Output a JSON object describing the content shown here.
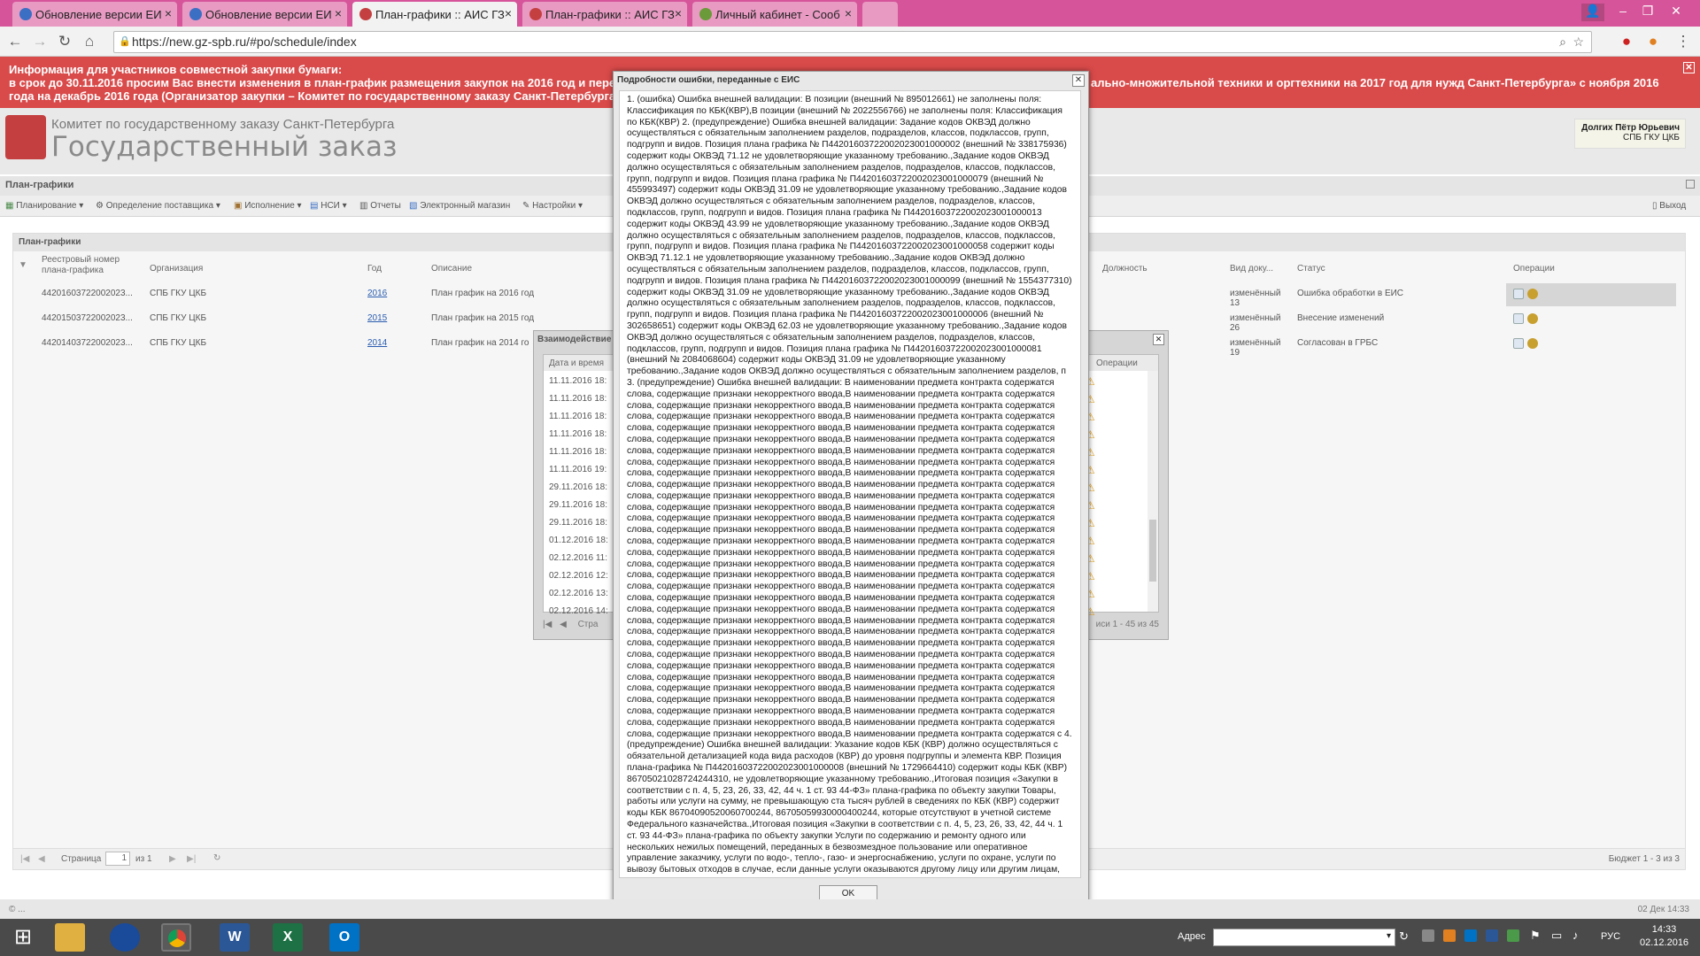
{
  "browser": {
    "tabs": [
      {
        "label": "Обновление версии ЕИ",
        "active": false
      },
      {
        "label": "Обновление версии ЕИ",
        "active": false
      },
      {
        "label": "План-графики :: АИС ГЗ",
        "active": true
      },
      {
        "label": "План-графики :: АИС ГЗ",
        "active": false
      },
      {
        "label": "Личный кабинет - Сооб",
        "active": false
      }
    ],
    "url": "https://new.gz-spb.ru/#po/schedule/index"
  },
  "notice": {
    "title": "Информация для участников совместной закупки бумаги:",
    "line2": "в срок до 30.11.2016 просим Вас внести изменения в план-график размещения закупок на 2016 год и пере",
    "line2_right": "ально-множительной техники и оргтехники на 2017 год для нужд Санкт-Петербурга» с ноября 2016",
    "line3": "года на декабрь 2016 года (Организатор закупки – Комитет по государственному заказу Санкт-Петербурга"
  },
  "header": {
    "org": "Комитет по государственному заказу Санкт-Петербурга",
    "system": "Государственный заказ",
    "user_name": "Долгих Пётр Юрьевич",
    "user_org": "СПБ ГКУ ЦКБ"
  },
  "section_title": "План-графики",
  "menu": {
    "items": [
      "Планирование ▾",
      "Определение поставщика ▾",
      "Исполнение ▾",
      "НСИ ▾",
      "Отчеты",
      "Электронный магазин",
      "Настройки ▾"
    ],
    "logout": "Выход"
  },
  "grid": {
    "title": "План-графики",
    "columns": [
      "Реестровый номер плана-графика",
      "Организация",
      "Год",
      "Описание",
      "Должность",
      "Вид доку...",
      "Статус",
      "Операции"
    ],
    "rows": [
      {
        "reg": "44201603722002023...",
        "org": "СПБ ГКУ ЦКБ",
        "year": "2016",
        "desc": "План график на 2016 год",
        "doc": "изменённый 13",
        "status": "Ошибка обработки в ЕИС"
      },
      {
        "reg": "44201503722002023...",
        "org": "СПБ ГКУ ЦКБ",
        "year": "2015",
        "desc": "План график на 2015 год",
        "doc": "изменённый 26",
        "status": "Внесение изменений"
      },
      {
        "reg": "44201403722002023...",
        "org": "СПБ ГКУ ЦКБ",
        "year": "2014",
        "desc": "План график на 2014 го",
        "doc": "изменённый 19",
        "status": "Согласован в ГРБС"
      }
    ],
    "pager": {
      "page_label": "Страница",
      "page": "1",
      "of": "из 1",
      "summary": "Бюджет 1 - 3 из 3"
    }
  },
  "subwindow": {
    "title": "Взаимодействие",
    "col_date": "Дата и время",
    "col_ops": "Операции",
    "dates": [
      "11.11.2016 18:",
      "11.11.2016 18:",
      "11.11.2016 18:",
      "11.11.2016 18:",
      "11.11.2016 18:",
      "11.11.2016 19:",
      "29.11.2016 18:",
      "29.11.2016 18:",
      "29.11.2016 18:",
      "01.12.2016 18:",
      "02.12.2016 11:",
      "02.12.2016 12:",
      "02.12.2016 13:",
      "02.12.2016 14:"
    ],
    "pager_label": "Стра",
    "summary": "иси 1 - 45 из 45"
  },
  "modal": {
    "title": "Подробности ошибки, переданные с ЕИС",
    "body": "1. (ошибка) Ошибка внешней валидации: В позиции (внешний № 895012661) не заполнены поля: Классификация по КБК(КВР),В позиции (внешний № 2022556766) не заполнены поля: Классификация по КБК(КВР) 2. (предупреждение) Ошибка внешней валидации: Задание кодов ОКВЭД должно осуществляться с обязательным заполнением разделов, подразделов, классов, подклассов, групп, подгрупп и видов. Позиция плана графика № П44201603722002023001000002 (внешний № 338175936) содержит коды ОКВЭД 71.12 не удовлетворяющие указанному требованию.,Задание кодов ОКВЭД должно осуществляться с обязательным заполнением разделов, подразделов, классов, подклассов, групп, подгрупп и видов. Позиция плана графика № П44201603722002023001000079 (внешний № 455993497) содержит коды ОКВЭД 31.09 не удовлетворяющие указанному требованию.,Задание кодов ОКВЭД должно осуществляться с обязательным заполнением разделов, подразделов, классов, подклассов, групп, подгрупп и видов. Позиция плана графика № П44201603722002023001000013 содержит коды ОКВЭД 43.99 не удовлетворяющие указанному требованию.,Задание кодов ОКВЭД должно осуществляться с обязательным заполнением разделов, подразделов, классов, подклассов, групп, подгрупп и видов. Позиция плана графика № П44201603722002023001000058 содержит коды ОКВЭД 71.12.1 не удовлетворяющие указанному требованию.,Задание кодов ОКВЭД должно осуществляться с обязательным заполнением разделов, подразделов, классов, подклассов, групп, подгрупп и видов. Позиция плана графика № П44201603722002023001000099 (внешний № 1554377310) содержит коды ОКВЭД 31.09 не удовлетворяющие указанному требованию.,Задание кодов ОКВЭД должно осуществляться с обязательным заполнением разделов, подразделов, классов, подклассов, групп, подгрупп и видов. Позиция плана графика № П44201603722002023001000006 (внешний № 302658651) содержит коды ОКВЭД 62.03 не удовлетворяющие указанному требованию.,Задание кодов ОКВЭД должно осуществляться с обязательным заполнением разделов, подразделов, классов, подклассов, групп, подгрупп и видов. Позиция плана графика № П44201603722002023001000081 (внешний № 2084068604) содержит коды ОКВЭД 31.09 не удовлетворяющие указанному требованию.,Задание кодов ОКВЭД должно осуществляться с обязательным заполнением разделов, п 3. (предупреждение) Ошибка внешней валидации: В наименовании предмета контракта содержатся слова, содержащие признаки некорректного ввода,В наименовании предмета контракта содержатся слова, содержащие признаки некорректного ввода,В наименовании предмета контракта содержатся слова, содержащие признаки некорректного ввода,В наименовании предмета контракта содержатся слова, содержащие признаки некорректного ввода,В наименовании предмета контракта содержатся слова, содержащие признаки некорректного ввода,В наименовании предмета контракта содержатся слова, содержащие признаки некорректного ввода,В наименовании предмета контракта содержатся слова, содержащие признаки некорректного ввода,В наименовании предмета контракта содержатся слова, содержащие признаки некорректного ввода,В наименовании предмета контракта содержатся слова, содержащие признаки некорректного ввода,В наименовании предмета контракта содержатся слова, содержащие признаки некорректного ввода,В наименовании предмета контракта содержатся слова, содержащие признаки некорректного ввода,В наименовании предмета контракта содержатся слова, содержащие признаки некорректного ввода,В наименовании предмета контракта содержатся слова, содержащие признаки некорректного ввода,В наименовании предмета контракта содержатся слова, содержащие признаки некорректного ввода,В наименовании предмета контракта содержатся слова, содержащие признаки некорректного ввода,В наименовании предмета контракта содержатся слова, содержащие признаки некорректного ввода,В наименовании предмета контракта содержатся слова, содержащие признаки некорректного ввода,В наименовании предмета контракта содержатся слова, содержащие признаки некорректного ввода,В наименовании предмета контракта содержатся слова, содержащие признаки некорректного ввода,В наименовании предмета контракта содержатся слова, содержащие признаки некорректного ввода,В наименовании предмета контракта содержатся слова, содержащие признаки некорректного ввода,В наименовании предмета контракта содержатся слова, содержащие признаки некорректного ввода,В наименовании предмета контракта содержатся слова, содержащие признаки некорректного ввода,В наименовании предмета контракта содержатся слова, содержащие признаки некорректного ввода,В наименовании предмета контракта содержатся слова, содержащие признаки некорректного ввода,В наименовании предмета контракта содержатся слова, содержащие признаки некорректного ввода,В наименовании предмета контракта содержатся слова, содержащие признаки некорректного ввода,В наименовании предмета контракта содержатся слова, содержащие признаки некорректного ввода,В наименовании предмета контракта содержатся слова, содержащие признаки некорректного ввода,В наименовании предмета контракта содержатся слова, содержащие признаки некорректного ввода,В наименовании предмета контракта содержатся слова, содержащие признаки некорректного ввода,В наименовании предмета контракта содержатся с 4. (предупреждение) Ошибка внешней валидации: Указание кодов КБК (КВР) должно осуществляться с обязательной детализацией кода вида расходов (КВР) до уровня подгруппы и элемента КВР. Позиция плана-графика № П44201603722002023001000008 (внешний № 1729664410) содержит коды КБК (КВР) 86705021028724244310, не удовлетворяющие указанному требованию.,Итоговая позиция «Закупки в соответствии с п. 4, 5, 23, 26, 33, 42, 44 ч. 1 ст. 93 44-ФЗ» плана-графика по объекту закупки Товары, работы или услуги на сумму, не превышающую ста тысяч рублей в сведениях по КБК (КВР) содержит коды КБК 86704090520060700244, 86705059930000400244, которые отсутствуют в учетной системе Федерального казначейства.,Итоговая позиция «Закупки в соответствии с п. 4, 5, 23, 26, 33, 42, 44 ч. 1 ст. 93 44-ФЗ» плана-графика по объекту закупки Услуги по содержанию и ремонту одного или нескольких нежилых помещений, переданных в безвозмездное пользование или оперативное управление заказчику, услуги по водо-, тепло-, газо- и энергоснабжению, услуги по охране, услуги по вывозу бытовых отходов в случае, если данные услуги оказываются другому лицу или другим лицам, пользующимся нежилыми помещениями, находящимися в здании, в котором расположены помещения, переданные заказчику в безвозмездное пользование или оперативное управление в сведениях по КБК (КВР) содержит коды КБК 86705059930000400244, которые отсутствуют в учетной системе Федерального казначейства.,Значение итогового показателя «Годовой объем закупок, осуществляемых путем запроса котировок» не соответствует суммарному объему планируемых закупок, указанному в позициях плана-графика, у которых установлен способ определения поставщика «Запрос котировок»",
    "ok_label": "OK"
  },
  "footer": {
    "left": "© ...",
    "right": "02 Дек 14:33"
  },
  "taskbar": {
    "address_label": "Адрес",
    "lang": "РУС",
    "time": "14:33",
    "date": "02.12.2016"
  }
}
